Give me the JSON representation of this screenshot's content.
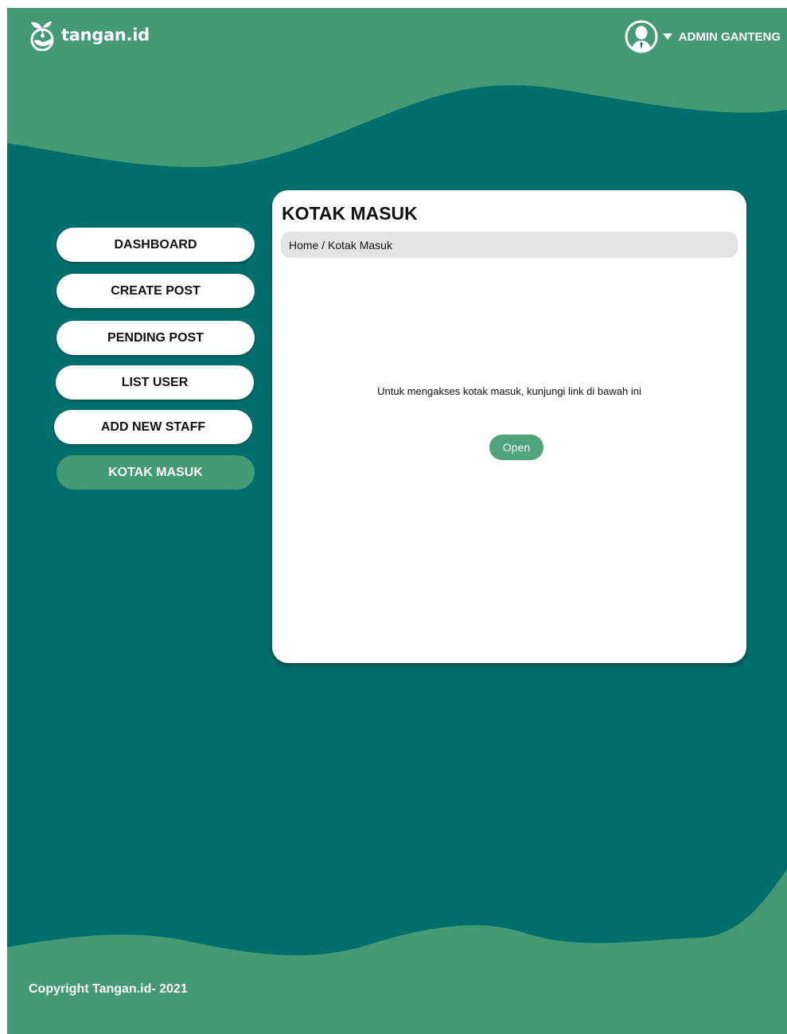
{
  "colors": {
    "teal": "#006f6b",
    "green": "#439a74",
    "button_green": "#4ea57b",
    "white": "#ffffff",
    "breadcrumb_bg": "#e4e4e4"
  },
  "header": {
    "logo_text": "tangan.id",
    "logo_icon": "plant-hand-icon",
    "user": {
      "avatar_icon": "user-avatar-icon",
      "caret_icon": "caret-down-icon",
      "name": "ADMIN GANTENG"
    }
  },
  "sidebar": {
    "items": [
      {
        "label": "DASHBOARD",
        "active": false
      },
      {
        "label": "CREATE POST",
        "active": false
      },
      {
        "label": "PENDING POST",
        "active": false
      },
      {
        "label": "LIST USER",
        "active": false
      },
      {
        "label": "ADD NEW STAFF",
        "active": false
      },
      {
        "label": "KOTAK MASUK",
        "active": true
      }
    ]
  },
  "main": {
    "title": "KOTAK MASUK",
    "breadcrumb": "Home / Kotak Masuk",
    "message": "Untuk mengakses kotak masuk, kunjungi link di bawah ini",
    "open_label": "Open"
  },
  "footer": {
    "copyright": "Copyright Tangan.id- 2021"
  }
}
